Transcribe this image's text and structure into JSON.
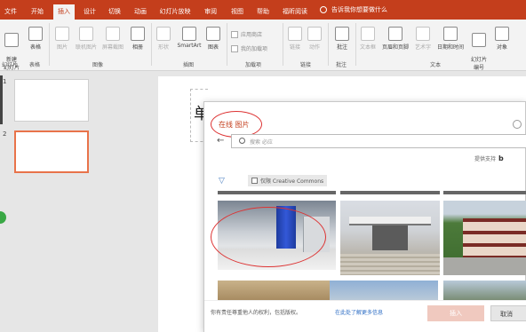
{
  "tabs": [
    {
      "label": "文件"
    },
    {
      "label": "开始"
    },
    {
      "label": "插入"
    },
    {
      "label": "设计"
    },
    {
      "label": "切换"
    },
    {
      "label": "动画"
    },
    {
      "label": "幻灯片放映"
    },
    {
      "label": "审阅"
    },
    {
      "label": "视图"
    },
    {
      "label": "帮助"
    },
    {
      "label": "福昕阅读"
    }
  ],
  "tell_me": "告诉我你想要做什么",
  "ribbon": {
    "new_slide": "新建\n幻灯片",
    "table": "表格",
    "pictures": "图片",
    "online_pictures": "联机图片",
    "screenshot": "屏幕截图",
    "album": "相册",
    "shapes": "形状",
    "icons": "图标",
    "smartart": "SmartArt",
    "chart": "图表",
    "store": "应用商店",
    "my_addins": "我的加载项",
    "link": "链接",
    "action": "动作",
    "comment": "批注",
    "textbox": "文本框",
    "header_footer": "页眉和页脚",
    "wordart": "艺术字",
    "datetime": "日期和时间",
    "slide_number": "幻灯片\n编号",
    "object": "对象",
    "groups": {
      "slides": "幻灯片",
      "tables": "表格",
      "images": "图像",
      "illustrations": "插图",
      "addins": "加载项",
      "links": "链接",
      "comments": "批注",
      "text": "文本"
    }
  },
  "thumbnails": [
    {
      "number": "1"
    },
    {
      "number": "2"
    }
  ],
  "slide_text": "单",
  "dialog": {
    "title": "在线 图片",
    "search_placeholder": "搜索 必应",
    "provider_label": "提供支持",
    "provider_logo": "b",
    "filter_label": "仅限 Creative Commons",
    "footer_text": "你有责任尊重他人的权利，包括版权。",
    "footer_link": "在此处了解更多信息",
    "insert_button": "插入",
    "cancel_button": "取消"
  },
  "colors": {
    "accent": "#c43e1c",
    "link": "#2b6cc4",
    "annotation": "#dd3333"
  }
}
